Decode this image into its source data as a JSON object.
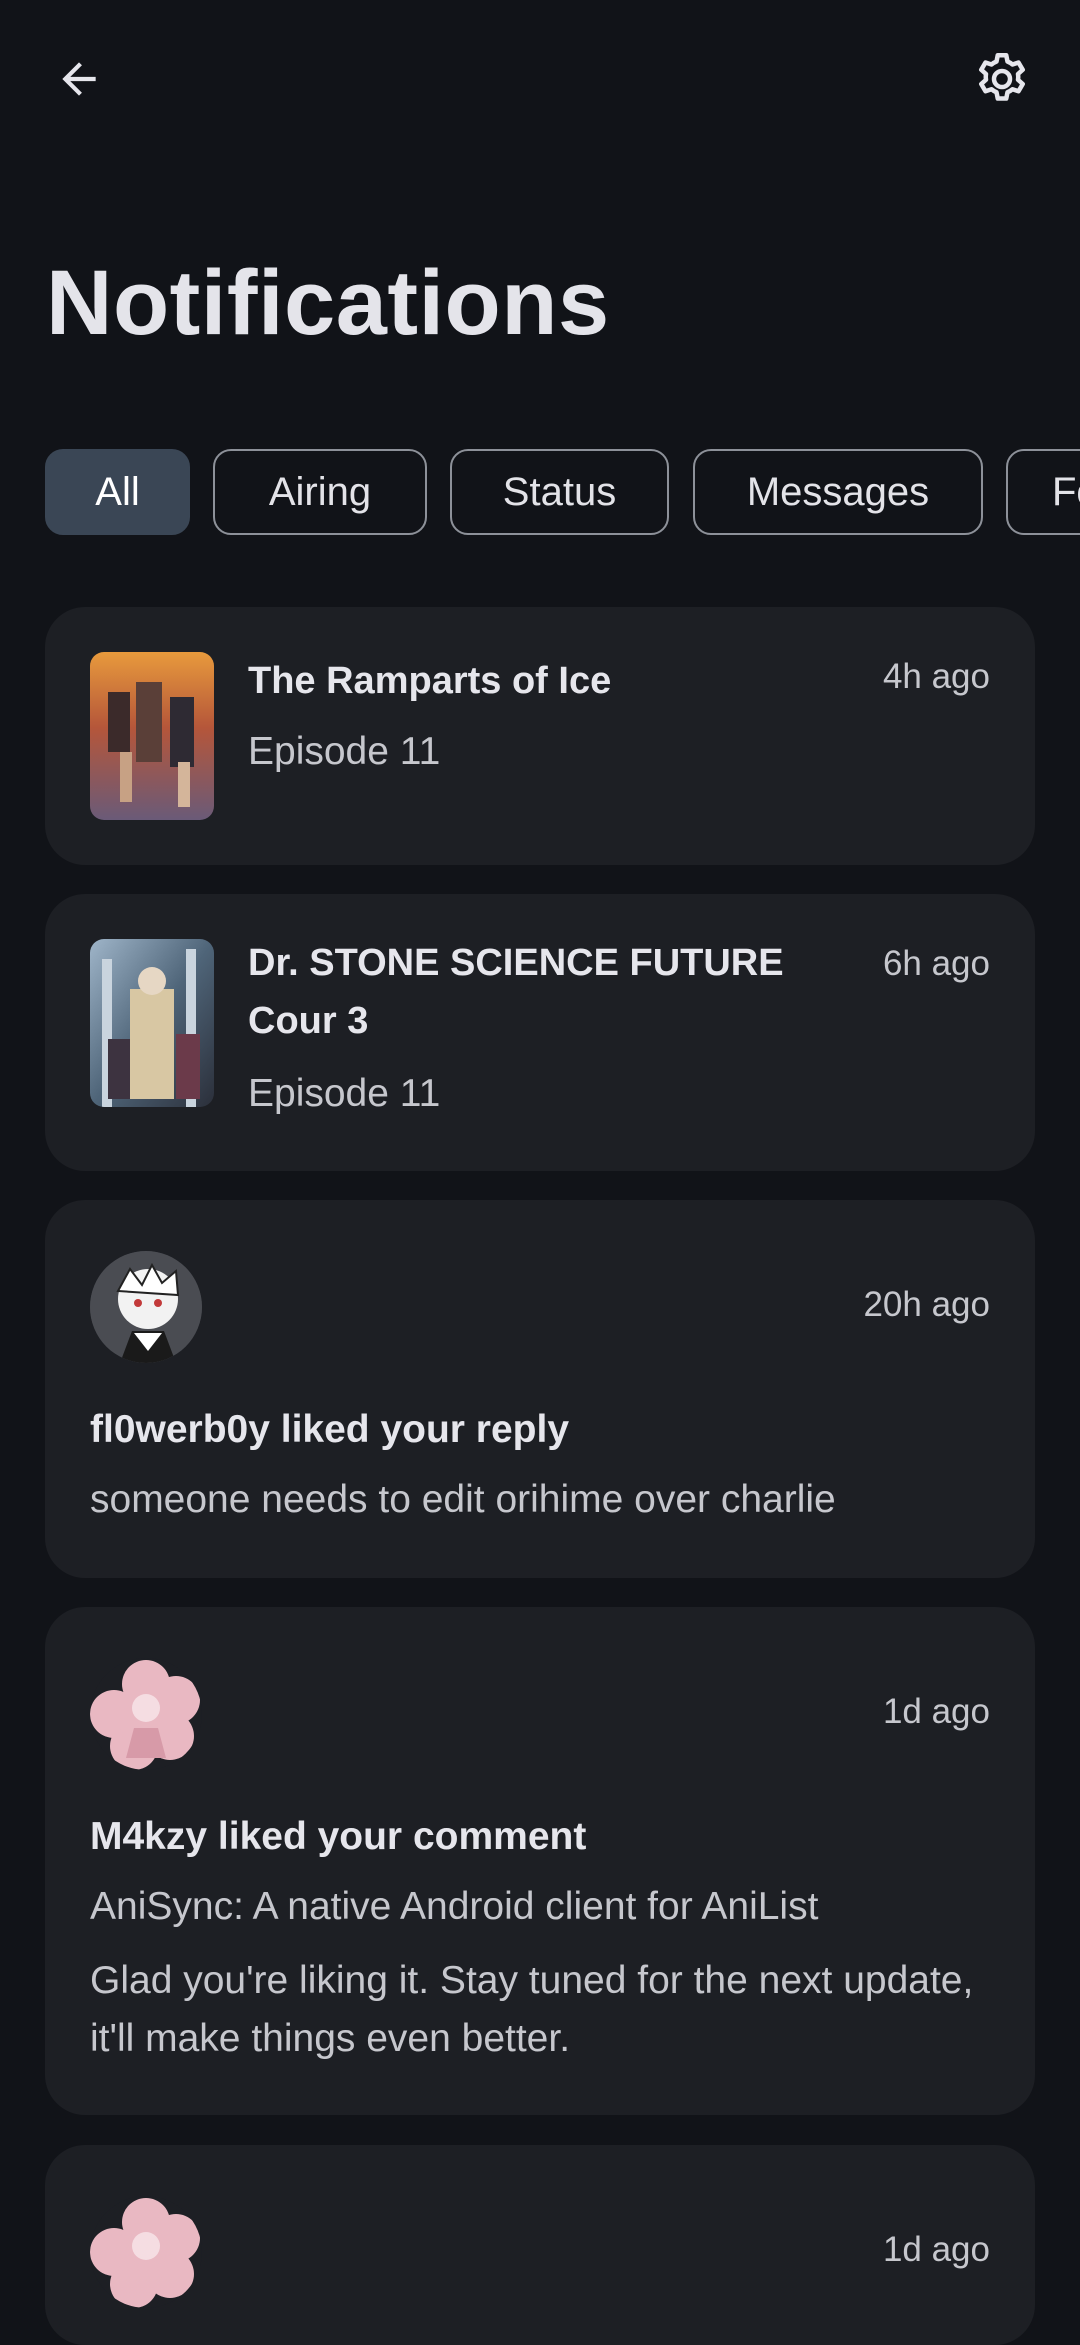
{
  "header": {
    "back_icon": "arrow-left-icon",
    "settings_icon": "gear-icon",
    "title": "Notifications"
  },
  "filters": [
    {
      "label": "All",
      "selected": true
    },
    {
      "label": "Airing",
      "selected": false
    },
    {
      "label": "Status",
      "selected": false
    },
    {
      "label": "Messages",
      "selected": false
    },
    {
      "label": "Fo",
      "selected": false
    }
  ],
  "notifications": [
    {
      "title": "The Ramparts of Ice",
      "subtitle": "Episode 11",
      "time": "4h ago"
    },
    {
      "title": "Dr. STONE SCIENCE FUTURE Cour 3",
      "subtitle": "Episode 11",
      "time": "6h ago"
    },
    {
      "time": "20h ago",
      "title": "fl0werb0y liked your reply",
      "text": "someone needs to edit orihime over charlie"
    },
    {
      "time": "1d ago",
      "title": "M4kzy liked your comment",
      "text": "AniSync: A native Android client for AniList",
      "text2": "Glad you're liking it. Stay tuned for the next update, it'll make things even better."
    },
    {
      "time": "1d ago"
    }
  ],
  "colors": {
    "background": "#111318",
    "card": "#1d1f24",
    "chip_selected": "#3a4655",
    "chip_border": "#8d9199"
  }
}
